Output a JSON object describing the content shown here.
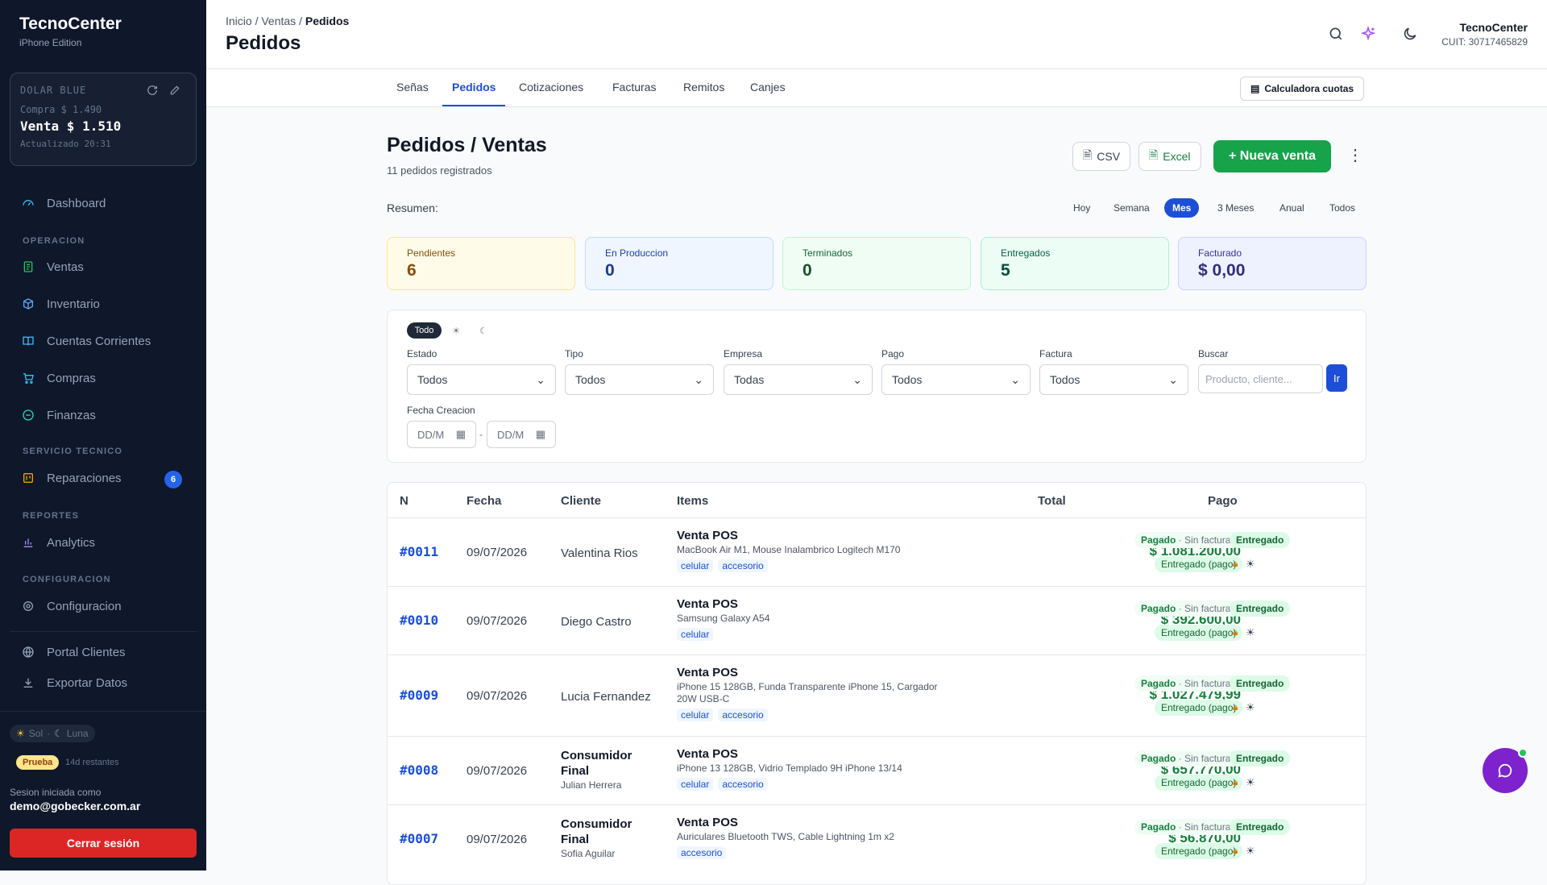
{
  "app": {
    "name": "TecnoCenter",
    "edition": "iPhone Edition"
  },
  "dolar": {
    "label": "DOLAR BLUE",
    "compra": "Compra $ 1.490",
    "venta": "Venta $ 1.510",
    "updated": "Actualizado 20:31"
  },
  "sidebar": {
    "dashboard": "Dashboard",
    "sec_operacion": "OPERACION",
    "ventas": "Ventas",
    "inventario": "Inventario",
    "cuentas": "Cuentas Corrientes",
    "compras": "Compras",
    "finanzas": "Finanzas",
    "sec_servicio": "SERVICIO TECNICO",
    "reparaciones": "Reparaciones",
    "reparaciones_badge": "6",
    "sec_reportes": "REPORTES",
    "analytics": "Analytics",
    "sec_config": "CONFIGURACION",
    "configuracion": "Configuracion",
    "portal": "Portal Clientes",
    "exportar": "Exportar Datos",
    "sol": "Sol",
    "luna": "Luna",
    "prueba": "Prueba",
    "restantes": "14d restantes",
    "sesion_label": "Sesion iniciada como",
    "email": "demo@gobecker.com.ar",
    "logout": "Cerrar sesión"
  },
  "header": {
    "crumb_inicio": "Inicio",
    "crumb_ventas": "Ventas",
    "crumb_pedidos": "Pedidos",
    "title": "Pedidos",
    "org_name": "TecnoCenter",
    "org_cuit": "CUIT: 30717465829"
  },
  "tabs": [
    "Señas",
    "Pedidos",
    "Cotizaciones",
    "Facturas",
    "Remitos",
    "Canjes"
  ],
  "calc_button": "Calculadora cuotas",
  "page": {
    "title": "Pedidos / Ventas",
    "subtitle": "11 pedidos registrados"
  },
  "actions": {
    "csv": "CSV",
    "excel": "Excel",
    "new": "+ Nueva venta"
  },
  "resumen": {
    "label": "Resumen:",
    "periods": [
      "Hoy",
      "Semana",
      "Mes",
      "3 Meses",
      "Anual",
      "Todos"
    ],
    "selected": "Mes"
  },
  "cards": [
    {
      "label": "Pendientes",
      "value": "6"
    },
    {
      "label": "En Produccion",
      "value": "0"
    },
    {
      "label": "Terminados",
      "value": "0"
    },
    {
      "label": "Entregados",
      "value": "5"
    },
    {
      "label": "Facturado",
      "value": "$ 0,00"
    }
  ],
  "filters": {
    "mode_todo": "Todo",
    "estado_label": "Estado",
    "estado_value": "Todos",
    "tipo_label": "Tipo",
    "tipo_value": "Todos",
    "empresa_label": "Empresa",
    "empresa_value": "Todas",
    "pago_label": "Pago",
    "pago_value": "Todos",
    "factura_label": "Factura",
    "factura_value": "Todos",
    "buscar_label": "Buscar",
    "buscar_placeholder": "Producto, cliente...",
    "ir": "Ir",
    "fecha_label": "Fecha Creacion",
    "fecha_from": "DD/M",
    "fecha_to": "DD/M"
  },
  "table": {
    "headers": {
      "n": "N",
      "fecha": "Fecha",
      "cliente": "Cliente",
      "items": "Items",
      "total": "Total",
      "pago": "Pago"
    },
    "rows": [
      {
        "n": "#0011",
        "fecha": "09/07/2026",
        "cliente": "Valentina Rios",
        "cliente_sub": "",
        "item_title": "Venta POS",
        "item_desc": "MacBook Air M1, Mouse Inalambrico Logitech M170",
        "tags": [
          "celular",
          "accesorio"
        ],
        "total": "$ 1.081.200,00",
        "pago_a": "Pagado",
        "pago_b": "· Sin facturar",
        "entregado": "Entregado",
        "entregado_pago": "Entregado (pago)"
      },
      {
        "n": "#0010",
        "fecha": "09/07/2026",
        "cliente": "Diego Castro",
        "cliente_sub": "",
        "item_title": "Venta POS",
        "item_desc": "Samsung Galaxy A54",
        "tags": [
          "celular"
        ],
        "total": "$ 392.600,00",
        "pago_a": "Pagado",
        "pago_b": "· Sin facturar",
        "entregado": "Entregado",
        "entregado_pago": "Entregado (pago)"
      },
      {
        "n": "#0009",
        "fecha": "09/07/2026",
        "cliente": "Lucia Fernandez",
        "cliente_sub": "",
        "item_title": "Venta POS",
        "item_desc": "iPhone 15 128GB, Funda Transparente iPhone 15, Cargador 20W USB-C",
        "tags": [
          "celular",
          "accesorio"
        ],
        "total": "$ 1.027.479,99",
        "pago_a": "Pagado",
        "pago_b": "· Sin facturar",
        "entregado": "Entregado",
        "entregado_pago": "Entregado (pago)"
      },
      {
        "n": "#0008",
        "fecha": "09/07/2026",
        "cliente": "Consumidor Final",
        "cliente_sub": "Julian Herrera",
        "item_title": "Venta POS",
        "item_desc": "iPhone 13 128GB, Vidrio Templado 9H iPhone 13/14",
        "tags": [
          "celular",
          "accesorio"
        ],
        "total": "$ 657.770,00",
        "pago_a": "Pagado",
        "pago_b": "· Sin facturar",
        "entregado": "Entregado",
        "entregado_pago": "Entregado (pago)"
      },
      {
        "n": "#0007",
        "fecha": "09/07/2026",
        "cliente": "Consumidor Final",
        "cliente_sub": "Sofia Aguilar",
        "item_title": "Venta POS",
        "item_desc": "Auriculares Bluetooth TWS, Cable Lightning 1m x2",
        "tags": [
          "accesorio"
        ],
        "total": "$ 56.870,00",
        "pago_a": "Pagado",
        "pago_b": "· Sin facturar",
        "entregado": "Entregado",
        "entregado_pago": "Entregado (pago)"
      }
    ]
  }
}
